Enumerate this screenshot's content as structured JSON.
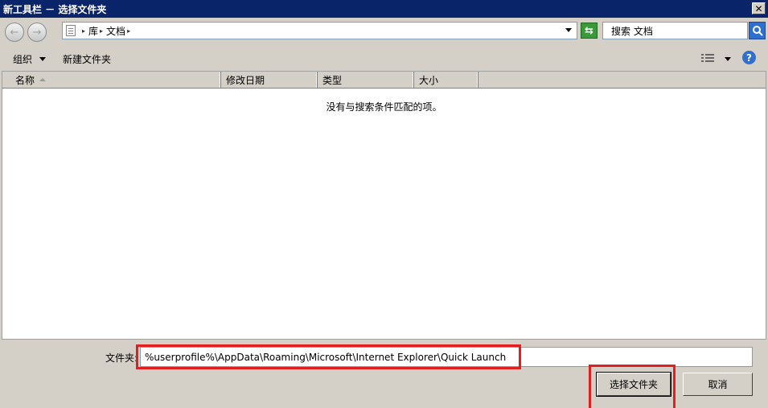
{
  "window": {
    "title": "新工具栏 － 选择文件夹",
    "close_glyph": "✕"
  },
  "nav": {
    "back_glyph": "←",
    "forward_glyph": "→",
    "crumbs": [
      "库",
      "文档"
    ],
    "crumb_sep": "▸",
    "refresh_glyph": "⇆",
    "search_placeholder": "搜索 文档"
  },
  "toolbar": {
    "organize_label": "组织",
    "new_folder_label": "新建文件夹",
    "help_glyph": "?"
  },
  "list": {
    "columns": [
      "名称",
      "修改日期",
      "类型",
      "大小"
    ],
    "empty_message": "没有与搜索条件匹配的项。"
  },
  "footer": {
    "folder_label": "文件夹:",
    "folder_value": "%userprofile%\\AppData\\Roaming\\Microsoft\\Internet Explorer\\Quick Launch",
    "select_label": "选择文件夹",
    "cancel_label": "取消"
  },
  "colors": {
    "highlight": "#e02020",
    "titlebar": "#0a246a"
  }
}
